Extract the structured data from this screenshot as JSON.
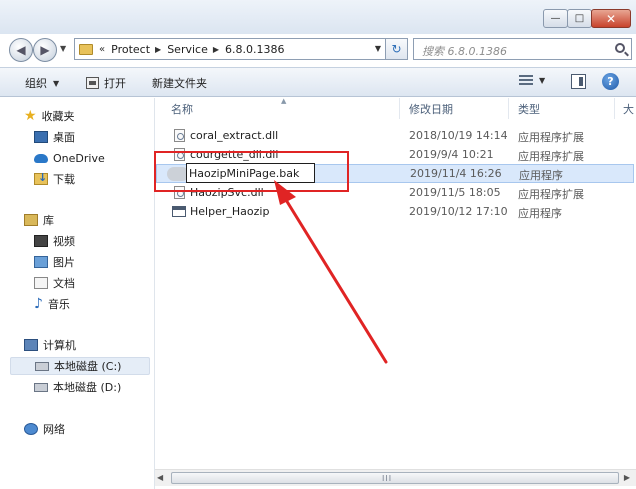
{
  "titlebar": {
    "minimize_glyph": "—",
    "maximize_glyph": "□",
    "close_glyph": "✕"
  },
  "address": {
    "overflow": "«",
    "crumbs": [
      "Protect",
      "Service",
      "6.8.0.1386"
    ],
    "separator": "▶",
    "dropdown": "▼",
    "refresh": "↻"
  },
  "search": {
    "placeholder": "搜索 6.8.0.1386"
  },
  "toolbar": {
    "organize": "组织",
    "open": "打开",
    "new_folder": "新建文件夹",
    "caret": "▼",
    "help": "?"
  },
  "nav": {
    "favorites": "收藏夹",
    "desktop": "桌面",
    "onedrive": "OneDrive",
    "downloads": "下载",
    "libraries": "库",
    "videos": "视频",
    "pictures": "图片",
    "documents": "文档",
    "music": "音乐",
    "computer": "计算机",
    "drive_c": "本地磁盘 (C:)",
    "drive_d": "本地磁盘 (D:)",
    "network": "网络"
  },
  "columns": {
    "name": "名称",
    "date": "修改日期",
    "type": "类型",
    "extra": "大"
  },
  "files": [
    {
      "name": "coral_extract.dll",
      "date": "2018/10/19 14:14",
      "type": "应用程序扩展",
      "icon": "dll-icon"
    },
    {
      "name": "courgette_dll.dll",
      "date": "2019/9/4 10:21",
      "type": "应用程序扩展",
      "icon": "dll-icon"
    },
    {
      "name": "HaozipMiniPage.bak",
      "date": "2019/11/4 16:26",
      "type": "应用程序",
      "icon": "app-icon",
      "renaming": true
    },
    {
      "name": "HaozipSvc.dll",
      "date": "2019/11/5 18:05",
      "type": "应用程序扩展",
      "icon": "dll-icon"
    },
    {
      "name": "Helper_Haozip",
      "date": "2019/10/12 17:10",
      "type": "应用程序",
      "icon": "app-icon"
    }
  ],
  "rename": {
    "value": "HaozipMiniPage.bak"
  },
  "hscroll": {
    "left": "◀",
    "right": "▶",
    "grip": "III"
  },
  "colors": {
    "highlight": "#e02424",
    "selection": "#d9e8fb",
    "toolbar": "#dde6f1"
  }
}
